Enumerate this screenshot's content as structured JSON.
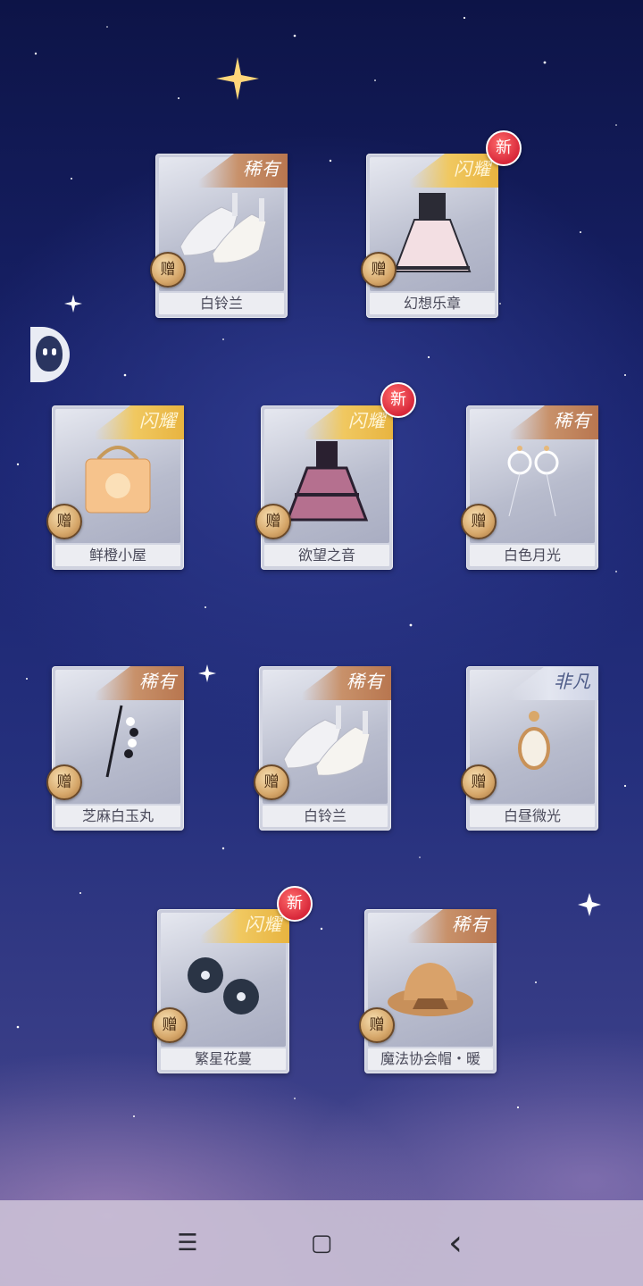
{
  "side_widget": {
    "icon": "mascot-icon"
  },
  "cards": [
    {
      "name": "白铃兰",
      "rarity": "稀有",
      "rarity_type": "rare",
      "gift": "赠",
      "is_new": false,
      "item_icon": "white-shoes-icon"
    },
    {
      "name": "幻想乐章",
      "rarity": "闪耀",
      "rarity_type": "shine",
      "gift": "赠",
      "is_new": true,
      "new_label": "新",
      "item_icon": "dress-icon"
    },
    {
      "name": "鲜橙小屋",
      "rarity": "闪耀",
      "rarity_type": "shine",
      "gift": "赠",
      "is_new": false,
      "item_icon": "handbag-icon"
    },
    {
      "name": "欲望之音",
      "rarity": "闪耀",
      "rarity_type": "shine",
      "gift": "赠",
      "is_new": true,
      "new_label": "新",
      "item_icon": "dark-dress-icon"
    },
    {
      "name": "白色月光",
      "rarity": "稀有",
      "rarity_type": "rare",
      "gift": "赠",
      "is_new": false,
      "item_icon": "earrings-icon"
    },
    {
      "name": "芝麻白玉丸",
      "rarity": "稀有",
      "rarity_type": "rare",
      "gift": "赠",
      "is_new": false,
      "item_icon": "pearl-hairpin-icon"
    },
    {
      "name": "白铃兰",
      "rarity": "稀有",
      "rarity_type": "rare",
      "gift": "赠",
      "is_new": false,
      "item_icon": "white-shoes-icon"
    },
    {
      "name": "白昼微光",
      "rarity": "非凡",
      "rarity_type": "extra",
      "gift": "赠",
      "is_new": false,
      "item_icon": "pendant-earring-icon"
    },
    {
      "name": "繁星花蔓",
      "rarity": "闪耀",
      "rarity_type": "shine",
      "gift": "赠",
      "is_new": true,
      "new_label": "新",
      "item_icon": "flower-hair-ornament-icon"
    },
    {
      "name": "魔法协会帽・暖",
      "rarity": "稀有",
      "rarity_type": "rare",
      "gift": "赠",
      "is_new": false,
      "item_icon": "hat-icon"
    }
  ],
  "navbar": {
    "menu_glyph": "☰",
    "home_glyph": "▢",
    "back_glyph": "‹"
  }
}
